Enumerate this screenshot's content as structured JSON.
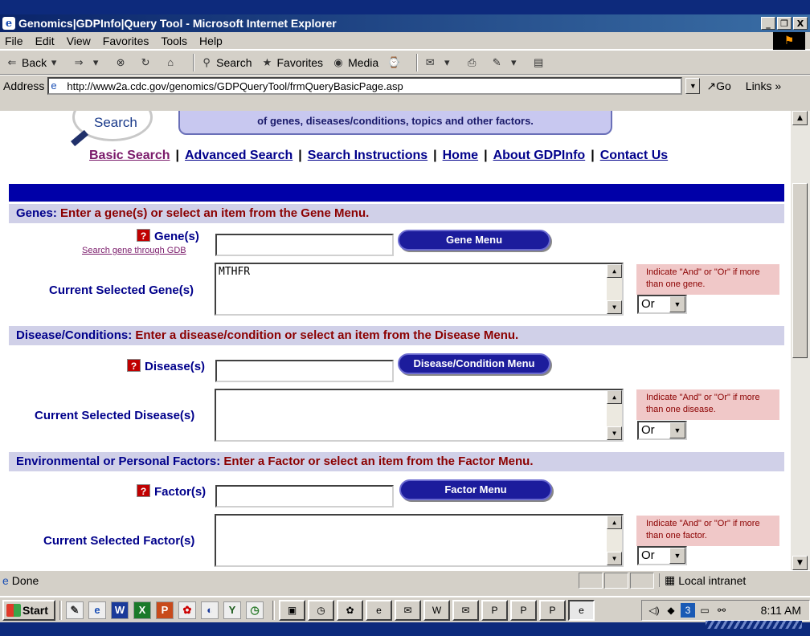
{
  "window": {
    "title": "Genomics|GDPInfo|Query Tool - Microsoft Internet Explorer",
    "buttons": [
      "_",
      "❐",
      "X"
    ]
  },
  "menubar": {
    "items": [
      "File",
      "Edit",
      "View",
      "Favorites",
      "Tools",
      "Help"
    ]
  },
  "toolbar": {
    "back": "Back",
    "search": "Search",
    "favorites": "Favorites",
    "media": "Media"
  },
  "address": {
    "label": "Address",
    "url": "http://www2a.cdc.gov/genomics/GDPQueryTool/frmQueryBasicPage.asp",
    "go": "Go",
    "links": "Links"
  },
  "page": {
    "logo_text": "Search",
    "intro_text": "of genes, diseases/conditions, topics and other factors.",
    "nav": [
      "Basic Search",
      "Advanced Search",
      "Search Instructions",
      "Home",
      "About GDPInfo",
      "Contact Us"
    ],
    "nav_sep": "|",
    "genes": {
      "head_key": "Genes:",
      "head_val": "Enter a gene(s) or select an item from the Gene Menu.",
      "input_label": "Gene(s)",
      "gdb_link": "Search gene through GDB",
      "menu_button": "Gene Menu",
      "current_label": "Current Selected Gene(s)",
      "current_value": "MTHFR",
      "hint": "Indicate \"And\" or \"Or\" if more than one gene.",
      "select": "Or"
    },
    "disease": {
      "head_key": "Disease/Conditions:",
      "head_val": "Enter a disease/condition or select an item from the Disease Menu.",
      "input_label": "Disease(s)",
      "menu_button": "Disease/Condition Menu",
      "current_label": "Current Selected Disease(s)",
      "current_value": "",
      "hint": "Indicate \"And\" or \"Or\" if more than one disease.",
      "select": "Or"
    },
    "factors": {
      "head_key": "Environmental or Personal Factors:",
      "head_val": "Enter a Factor or select an item from the Factor Menu.",
      "input_label": "Factor(s)",
      "menu_button": "Factor Menu",
      "current_label": "Current Selected Factor(s)",
      "current_value": "",
      "hint": "Indicate \"And\" or \"Or\" if more than one factor.",
      "select": "Or"
    }
  },
  "statusbar": {
    "status": "Done",
    "zone": "Local intranet"
  },
  "taskbar": {
    "start": "Start",
    "clock": "8:11 AM"
  }
}
